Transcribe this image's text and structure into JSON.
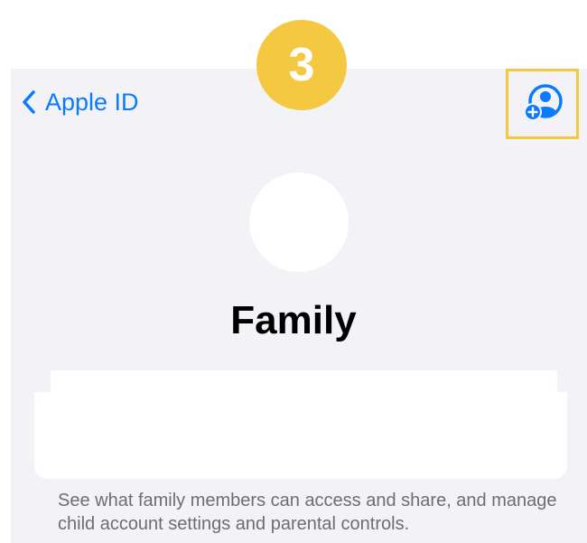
{
  "step_badge": {
    "number": "3",
    "color": "#f5c842"
  },
  "nav": {
    "back_label": "Apple ID",
    "back_icon": "chevron-left-icon",
    "add_member_icon": "person-add-icon",
    "accent": "#0a7aff"
  },
  "page": {
    "title": "Family",
    "description": "See what family members can access and share, and manage child account settings and parental controls."
  }
}
